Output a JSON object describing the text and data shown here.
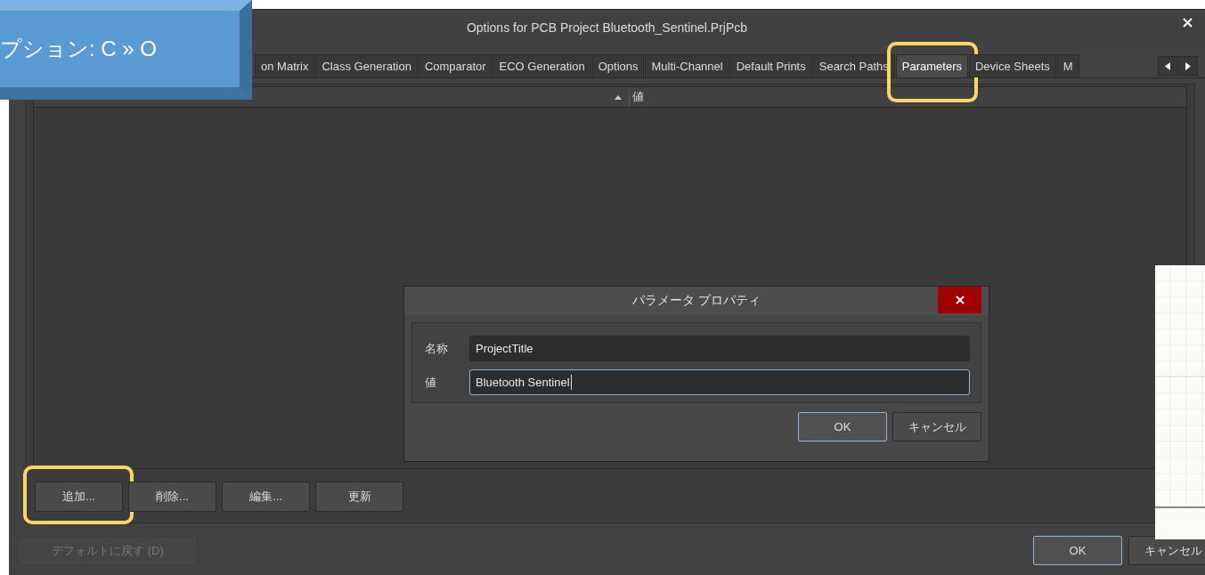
{
  "window": {
    "title": "Options for PCB Project Bluetooth_Sentinel.PrjPcb"
  },
  "callout": {
    "text": "プション: C » O"
  },
  "tabs": [
    {
      "label": "on Matrix",
      "selected": false,
      "highlighted": false
    },
    {
      "label": "Class Generation",
      "selected": false,
      "highlighted": false
    },
    {
      "label": "Comparator",
      "selected": false,
      "highlighted": false
    },
    {
      "label": "ECO Generation",
      "selected": false,
      "highlighted": false
    },
    {
      "label": "Options",
      "selected": false,
      "highlighted": false
    },
    {
      "label": "Multi-Channel",
      "selected": false,
      "highlighted": false
    },
    {
      "label": "Default Prints",
      "selected": false,
      "highlighted": false
    },
    {
      "label": "Search Paths",
      "selected": false,
      "highlighted": false
    },
    {
      "label": "Parameters",
      "selected": true,
      "highlighted": true
    },
    {
      "label": "Device Sheets",
      "selected": false,
      "highlighted": false
    },
    {
      "label": "M",
      "selected": false,
      "highlighted": false
    }
  ],
  "table": {
    "columns": [
      {
        "sorted": true
      },
      {
        "label": "値",
        "sorted": false
      }
    ]
  },
  "buttons": [
    {
      "label": "追加...",
      "highlighted": true
    },
    {
      "label": "削除...",
      "highlighted": false
    },
    {
      "label": "編集...",
      "highlighted": false
    },
    {
      "label": "更新",
      "highlighted": false
    }
  ],
  "dialog": {
    "title": "パラメータ プロパティ",
    "fields": [
      {
        "label": "名称",
        "value": "ProjectTitle",
        "focused": false
      },
      {
        "label": "値",
        "value": "Bluetooth Sentinel",
        "focused": true
      }
    ],
    "buttons": [
      {
        "label": "OK",
        "default": true
      },
      {
        "label": "キャンセル",
        "default": false
      }
    ]
  },
  "footer": {
    "reset": {
      "label": "デフォルトに戻す (D)",
      "disabled": true
    },
    "buttons": [
      {
        "label": "OK",
        "default": true
      },
      {
        "label": "キャンセル",
        "default": false
      }
    ]
  }
}
